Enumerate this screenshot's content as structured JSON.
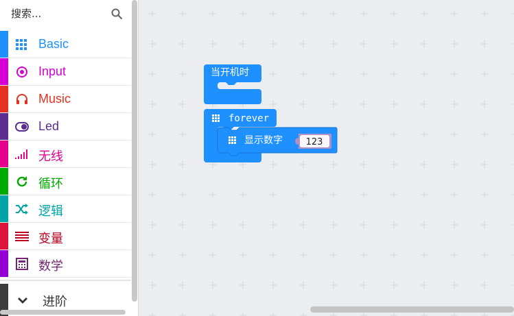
{
  "search": {
    "placeholder": "搜索..."
  },
  "categories": [
    {
      "label": "Basic",
      "color": "#1e90ff",
      "icon": "grid-icon"
    },
    {
      "label": "Input",
      "color": "#d400d4",
      "icon": "radio-target-icon"
    },
    {
      "label": "Music",
      "color": "#e63022",
      "icon": "headphones-icon"
    },
    {
      "label": "Led",
      "color": "#5c2d91",
      "icon": "toggle-icon"
    },
    {
      "label": "无线",
      "color": "#e3008c",
      "icon": "signal-bars-icon"
    },
    {
      "label": "循环",
      "color": "#00aa00",
      "icon": "refresh-icon"
    },
    {
      "label": "逻辑",
      "color": "#00a4a6",
      "icon": "shuffle-icon"
    },
    {
      "label": "变量",
      "color": "#dc143c",
      "icon": "variables-icon"
    },
    {
      "label": "数学",
      "color": "#9400d3",
      "icon": "calculator-icon"
    }
  ],
  "advanced": {
    "label": "进阶"
  },
  "blocks": {
    "on_start": "当开机时",
    "forever": "forever",
    "show_number": "显示数字",
    "number_value": "123"
  }
}
